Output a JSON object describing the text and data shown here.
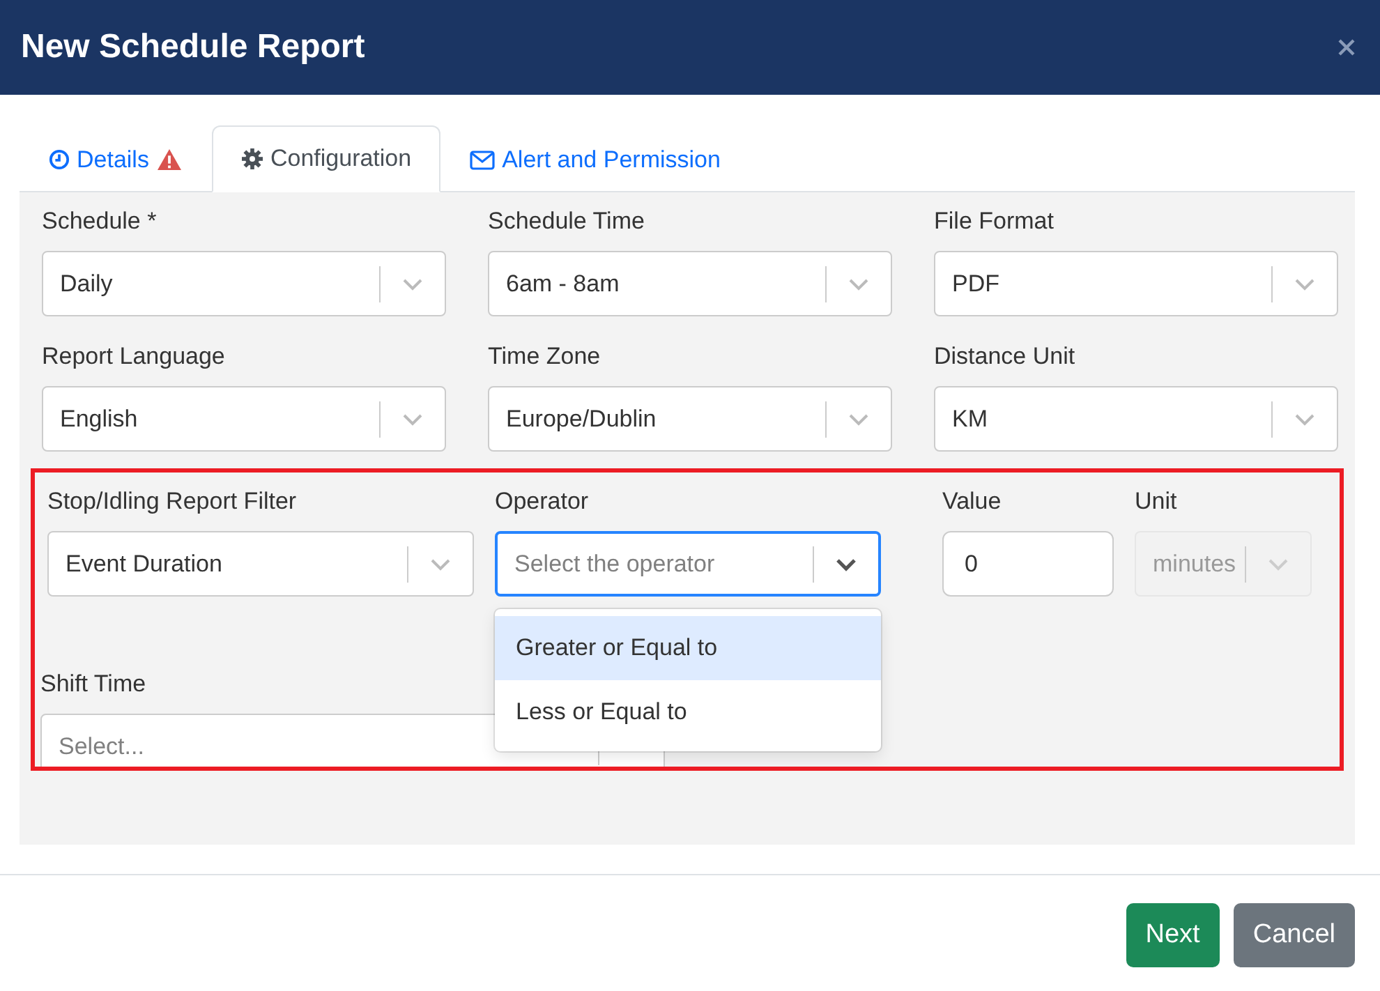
{
  "dialog": {
    "title": "New Schedule Report"
  },
  "tabs": [
    {
      "label": "Details",
      "selected": false,
      "warning": true
    },
    {
      "label": "Configuration",
      "selected": true,
      "warning": false
    },
    {
      "label": "Alert and Permission",
      "selected": false,
      "warning": false
    }
  ],
  "rows": [
    [
      {
        "label": "Schedule *",
        "value": "Daily"
      },
      {
        "label": "Schedule Time",
        "value": "6am - 8am"
      },
      {
        "label": "File Format",
        "value": "PDF"
      }
    ],
    [
      {
        "label": "Report Language",
        "value": "English"
      },
      {
        "label": "Time Zone",
        "value": "Europe/Dublin"
      },
      {
        "label": "Distance Unit",
        "value": "KM"
      }
    ]
  ],
  "filter": {
    "fields": [
      {
        "kind": "select",
        "label": "Stop/Idling Report Filter",
        "value": "Event Duration",
        "disabled": false
      },
      {
        "kind": "select",
        "label": "Operator",
        "placeholder": "Select the operator",
        "disabled": false,
        "expanded": true,
        "options": [
          {
            "label": "Greater or Equal to",
            "selected": true
          },
          {
            "label": "Less or Equal to",
            "selected": false
          }
        ]
      },
      {
        "kind": "input",
        "label": "Value",
        "value": "0"
      },
      {
        "kind": "select",
        "label": "Unit",
        "value": "minutes",
        "disabled": true
      }
    ],
    "shift_time": {
      "label": "Shift Time",
      "placeholder": "Select..."
    }
  },
  "buttons": [
    {
      "label": "Next",
      "kind": "primary"
    },
    {
      "label": "Cancel",
      "kind": "secondary"
    }
  ]
}
